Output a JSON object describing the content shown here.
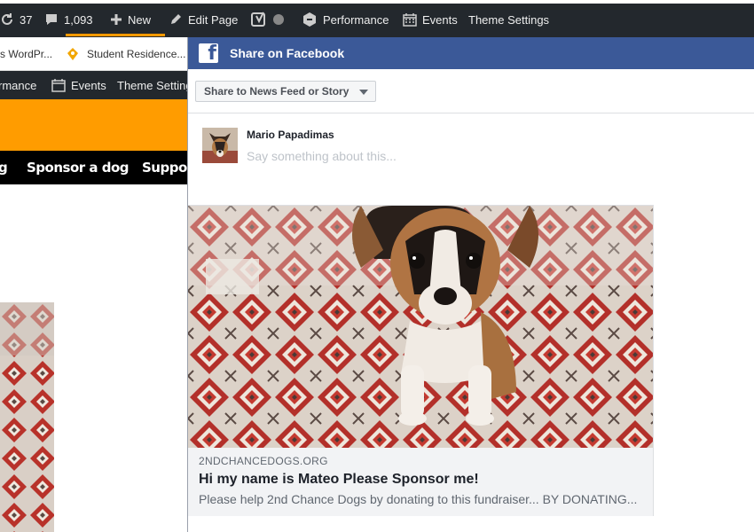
{
  "admin_bar": {
    "updates_count": "37",
    "comments_count": "1,093",
    "new_label": "New",
    "edit_page_label": "Edit Page",
    "performance_label": "Performance",
    "events_label": "Events",
    "theme_settings_label": "Theme Settings",
    "icons": [
      "refresh-icon",
      "comment-icon",
      "plus-icon",
      "pencil-icon",
      "yoast-icon",
      "status-dot-icon",
      "performance-icon",
      "calendar-icon"
    ]
  },
  "bookmarks": {
    "items": [
      {
        "label": "s WordPr...",
        "icon": "wordpress-icon"
      },
      {
        "label": "Student Residence...",
        "icon": "location-pin-icon"
      }
    ]
  },
  "site_admin_bar": {
    "performance_label": "rmance",
    "events_label": "Events",
    "theme_settings_label": "Theme Setting"
  },
  "site_nav": {
    "items": [
      "g",
      "Sponsor a dog",
      "Suppor"
    ]
  },
  "share_dialog": {
    "header_title": "Share on Facebook",
    "audience_select": "Share to News Feed or Story",
    "user_name": "Mario Papadimas",
    "message_placeholder": "Say something about this...",
    "link_preview": {
      "domain": "2NDCHANCEDOGS.ORG",
      "title": "Hi my name is Mateo Please Sponsor me!",
      "description": "Please help 2nd Chance Dogs by donating to this fundraiser... BY DONATING..."
    }
  },
  "colors": {
    "admin_bar_bg": "#23282d",
    "admin_highlight": "#ff9900",
    "site_orange": "#ff9c00",
    "facebook_blue": "#3b5998",
    "preview_meta_bg": "#f2f3f5"
  }
}
